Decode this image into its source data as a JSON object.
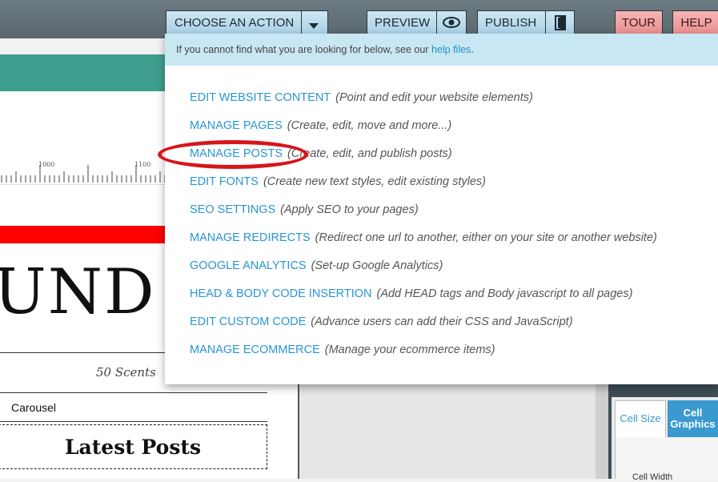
{
  "toolbar": {
    "choose_action_label": "CHOOSE AN ACTION",
    "preview_label": "PREVIEW",
    "publish_label": "PUBLISH",
    "tour_label": "TOUR",
    "help_label": "HELP"
  },
  "dropdown": {
    "info_text": "If you cannot find what you are looking for below, see our ",
    "info_link": "help files",
    "info_end": ".",
    "items": [
      {
        "label": "EDIT WEBSITE CONTENT",
        "desc": "(Point and edit your website elements)"
      },
      {
        "label": "MANAGE PAGES",
        "desc": "(Create, edit, move and more...)"
      },
      {
        "label": "MANAGE POSTS",
        "desc": "(Create, edit, and publish posts)"
      },
      {
        "label": "EDIT FONTS",
        "desc": "(Create new text styles, edit existing styles)"
      },
      {
        "label": "SEO SETTINGS",
        "desc": "(Apply SEO to your pages)"
      },
      {
        "label": "MANAGE REDIRECTS",
        "desc": "(Redirect one url to another, either on your site or another website)"
      },
      {
        "label": "GOOGLE ANALYTICS",
        "desc": "(Set-up Google Analytics)"
      },
      {
        "label": "HEAD & BODY CODE INSERTION",
        "desc": "(Add HEAD tags and Body javascript to all pages)"
      },
      {
        "label": "EDIT CUSTOM CODE",
        "desc": "(Advance users can add their CSS and JavaScript)"
      },
      {
        "label": "MANAGE ECOMMERCE",
        "desc": "(Manage your ecommerce items)"
      }
    ]
  },
  "editor": {
    "ruler_label_1": "1000",
    "ruler_label_2": "1100",
    "headline_fragment": "UND",
    "tagline": "50 Scents",
    "carousel_label": "Carousel",
    "latest_posts": "Latest Posts"
  },
  "right_panel": {
    "tab_cell_size": "Cell Size",
    "tab_cell_graphics": "Cell Graphics",
    "cell_width": "Cell Width"
  },
  "colors": {
    "accent_blue": "#2a95d4",
    "highlight_red": "#d8141b",
    "info_bg": "#c9e7f3",
    "teal": "#3f9f8e"
  }
}
